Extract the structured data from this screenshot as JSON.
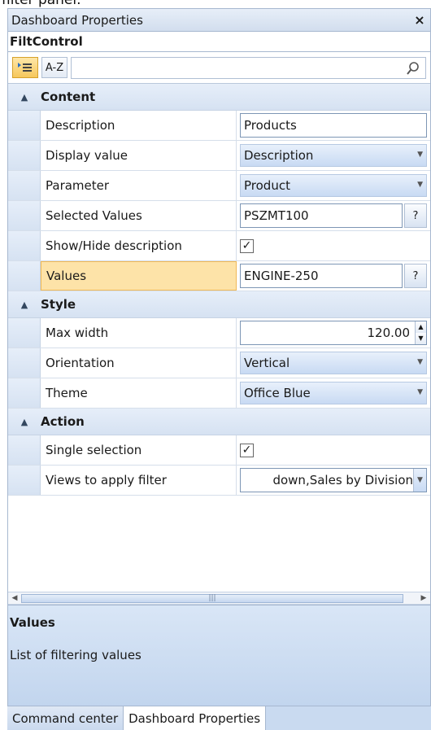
{
  "clipped_caption": "filter panel.",
  "window": {
    "title": "Dashboard Properties",
    "close_glyph": "×"
  },
  "object_name": "FiltControl",
  "toolbar": {
    "categorized_icon": "categorized-sort-icon",
    "az_label": "A-Z",
    "search_placeholder": "",
    "search_icon": "search-icon"
  },
  "categories": {
    "content": {
      "label": "Content"
    },
    "style": {
      "label": "Style"
    },
    "action": {
      "label": "Action"
    }
  },
  "props": {
    "description": {
      "name": "Description",
      "value": "Products"
    },
    "display_value": {
      "name": "Display value",
      "value": "Description"
    },
    "parameter": {
      "name": "Parameter",
      "value": "Product"
    },
    "selected_values": {
      "name": "Selected Values",
      "value": "PSZMT100",
      "button": "?"
    },
    "show_hide": {
      "name": "Show/Hide description",
      "checked": true
    },
    "values": {
      "name": "Values",
      "value": "ENGINE-250",
      "button": "?"
    },
    "max_width": {
      "name": "Max width",
      "value": "120.00"
    },
    "orientation": {
      "name": "Orientation",
      "value": "Vertical"
    },
    "theme": {
      "name": "Theme",
      "value": "Office Blue"
    },
    "single_selection": {
      "name": "Single selection",
      "checked": true
    },
    "views_filter": {
      "name": "Views to apply filter",
      "value": "down,Sales by Division"
    }
  },
  "help": {
    "title": "Values",
    "text": "List of filtering values"
  },
  "tabs": {
    "command_center": "Command center",
    "dashboard_properties": "Dashboard Properties"
  },
  "colors": {
    "accent": "#d6e2f2",
    "selected": "#fde3a8"
  }
}
